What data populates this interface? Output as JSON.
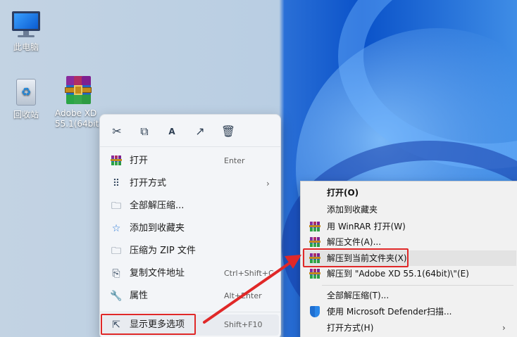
{
  "desktop": {
    "icons": [
      {
        "label": "此电脑"
      },
      {
        "label": "回收站"
      },
      {
        "label": "Adobe XD 55.1(64bit)"
      }
    ]
  },
  "modern_menu": {
    "toolbar": [
      "cut-icon",
      "copy-icon",
      "rename-icon",
      "share-icon",
      "delete-icon"
    ],
    "items": [
      {
        "label": "打开",
        "shortcut": "Enter"
      },
      {
        "label": "打开方式",
        "submenu": "›"
      },
      {
        "label": "全部解压缩..."
      },
      {
        "label": "添加到收藏夹"
      },
      {
        "label": "压缩为 ZIP 文件"
      },
      {
        "label": "复制文件地址",
        "shortcut": "Ctrl+Shift+C"
      },
      {
        "label": "属性",
        "shortcut": "Alt+Enter"
      },
      {
        "label": "显示更多选项",
        "shortcut": "Shift+F10"
      }
    ]
  },
  "classic_menu": {
    "items": [
      {
        "label": "打开(O)"
      },
      {
        "label": "添加到收藏夹"
      },
      {
        "label": "用 WinRAR 打开(W)"
      },
      {
        "label": "解压文件(A)..."
      },
      {
        "label": "解压到当前文件夹(X)"
      },
      {
        "label": "解压到 \"Adobe XD 55.1(64bit)\\\"(E)"
      },
      {
        "label": "全部解压缩(T)..."
      },
      {
        "label": "使用 Microsoft Defender扫描..."
      },
      {
        "label": "打开方式(H)",
        "submenu": "›"
      }
    ]
  },
  "annotation": {
    "highlight_color": "#e02828"
  }
}
